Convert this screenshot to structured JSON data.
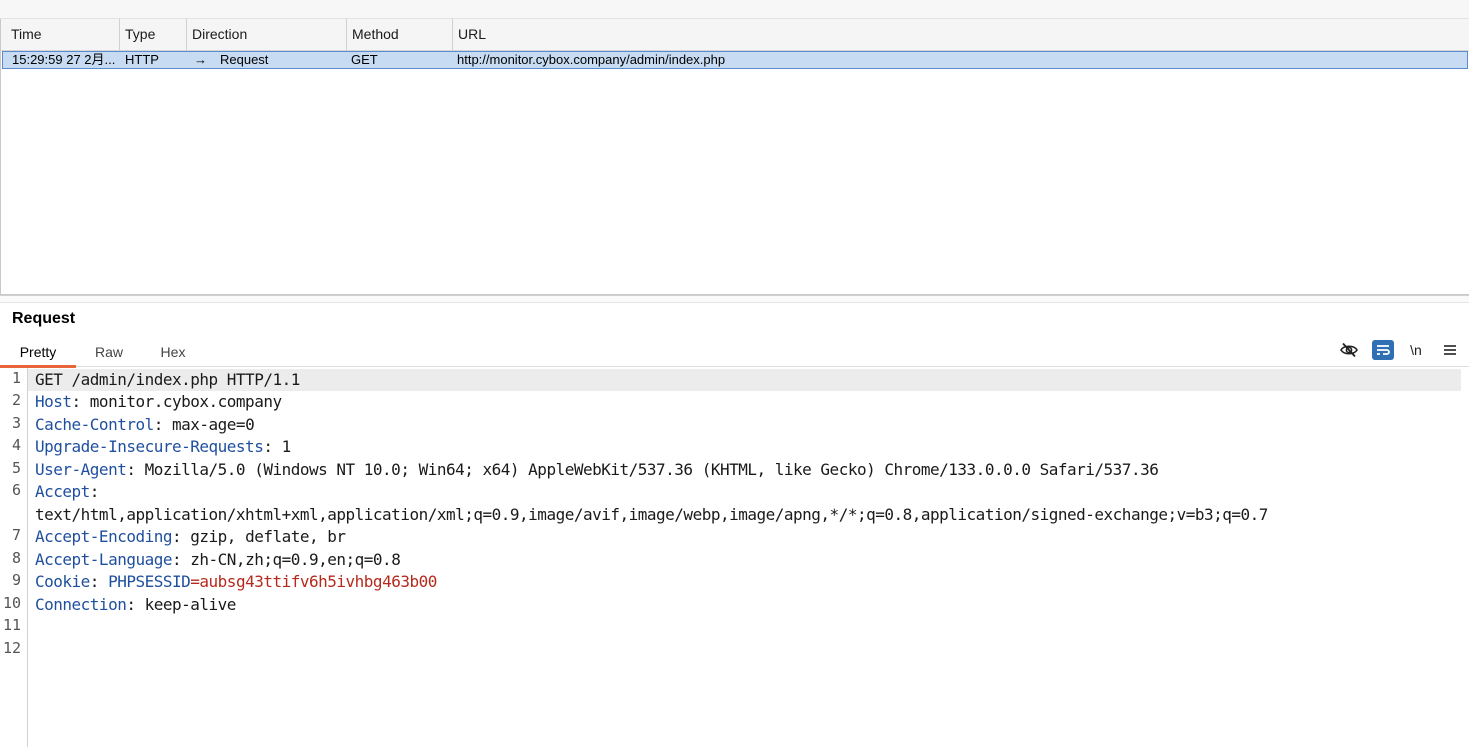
{
  "table": {
    "columns": [
      "Time",
      "Type",
      "Direction",
      "Method",
      "URL"
    ],
    "rows": [
      {
        "time": "15:29:59 27 2月...",
        "type": "HTTP",
        "direction_arrow": "→",
        "direction": "Request",
        "method": "GET",
        "url": "http://monitor.cybox.company/admin/index.php"
      }
    ]
  },
  "panel": {
    "title": "Request",
    "tabs": [
      "Pretty",
      "Raw",
      "Hex"
    ],
    "active_tab": "Pretty",
    "tools": {
      "hide_icon": "eye-off-icon",
      "wrap_icon": "wrap-icon",
      "newline_label": "\\n",
      "menu_icon": "menu-icon"
    }
  },
  "request_lines": [
    {
      "n": "1",
      "key": "",
      "sep": "",
      "val": "GET /admin/index.php HTTP/1.1"
    },
    {
      "n": "2",
      "key": "Host",
      "sep": ": ",
      "val": "monitor.cybox.company"
    },
    {
      "n": "3",
      "key": "Cache-Control",
      "sep": ": ",
      "val": "max-age=0"
    },
    {
      "n": "4",
      "key": "Upgrade-Insecure-Requests",
      "sep": ": ",
      "val": "1"
    },
    {
      "n": "5",
      "key": "User-Agent",
      "sep": ": ",
      "val": "Mozilla/5.0 (Windows NT 10.0; Win64; x64) AppleWebKit/537.36 (KHTML, like Gecko) Chrome/133.0.0.0 Safari/537.36"
    },
    {
      "n": "6",
      "key": "Accept",
      "sep": ":",
      "val": ""
    },
    {
      "n": "",
      "key": "",
      "sep": "",
      "val": "text/html,application/xhtml+xml,application/xml;q=0.9,image/avif,image/webp,image/apng,*/*;q=0.8,application/signed-exchange;v=b3;q=0.7"
    },
    {
      "n": "7",
      "key": "Accept-Encoding",
      "sep": ": ",
      "val": "gzip, deflate, br"
    },
    {
      "n": "8",
      "key": "Accept-Language",
      "sep": ": ",
      "val": "zh-CN,zh;q=0.9,en;q=0.8"
    },
    {
      "n": "9",
      "key": "Cookie",
      "sep": ": ",
      "cookie_name": "PHPSESSID",
      "cookie_eq": "=",
      "cookie_value": "aubsg43ttifv6h5ivhbg463b00"
    },
    {
      "n": "10",
      "key": "Connection",
      "sep": ": ",
      "val": "keep-alive"
    },
    {
      "n": "11",
      "key": "",
      "sep": "",
      "val": ""
    },
    {
      "n": "12",
      "key": "",
      "sep": "",
      "val": ""
    }
  ],
  "colors": {
    "selected_row": "#c7dbf2",
    "header_key": "#1f4f9e",
    "cookie_value": "#b52a1d",
    "active_tab_underline": "#e8643a",
    "wrap_button": "#2f6fb4"
  }
}
